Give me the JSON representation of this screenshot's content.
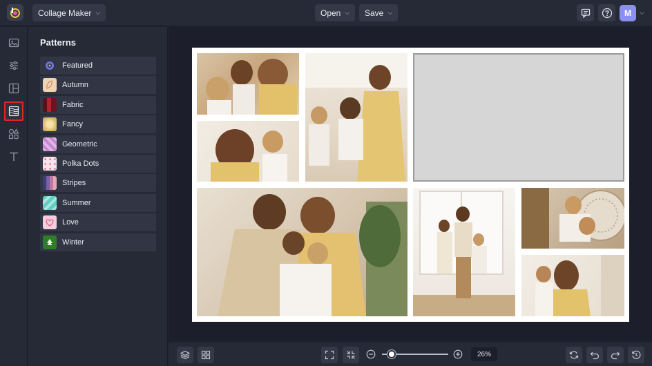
{
  "header": {
    "app_menu_label": "Collage Maker",
    "open_label": "Open",
    "save_label": "Save",
    "avatar_initial": "M"
  },
  "left_rail": {
    "items": [
      "image-icon",
      "adjustments-icon",
      "layouts-icon",
      "patterns-icon",
      "graphics-icon",
      "text-icon"
    ],
    "active": "patterns-icon"
  },
  "patterns_panel": {
    "title": "Patterns",
    "items": [
      {
        "label": "Featured"
      },
      {
        "label": "Autumn"
      },
      {
        "label": "Fabric"
      },
      {
        "label": "Fancy"
      },
      {
        "label": "Geometric"
      },
      {
        "label": "Polka Dots"
      },
      {
        "label": "Stripes"
      },
      {
        "label": "Summer"
      },
      {
        "label": "Love"
      },
      {
        "label": "Winter"
      }
    ]
  },
  "colors": {
    "accent_highlight": "#e0242b",
    "avatar": "#8b8ff0",
    "canvas_bg": "#1c1f2b"
  },
  "zoom": {
    "value_label": "26%",
    "level": 0.26
  }
}
